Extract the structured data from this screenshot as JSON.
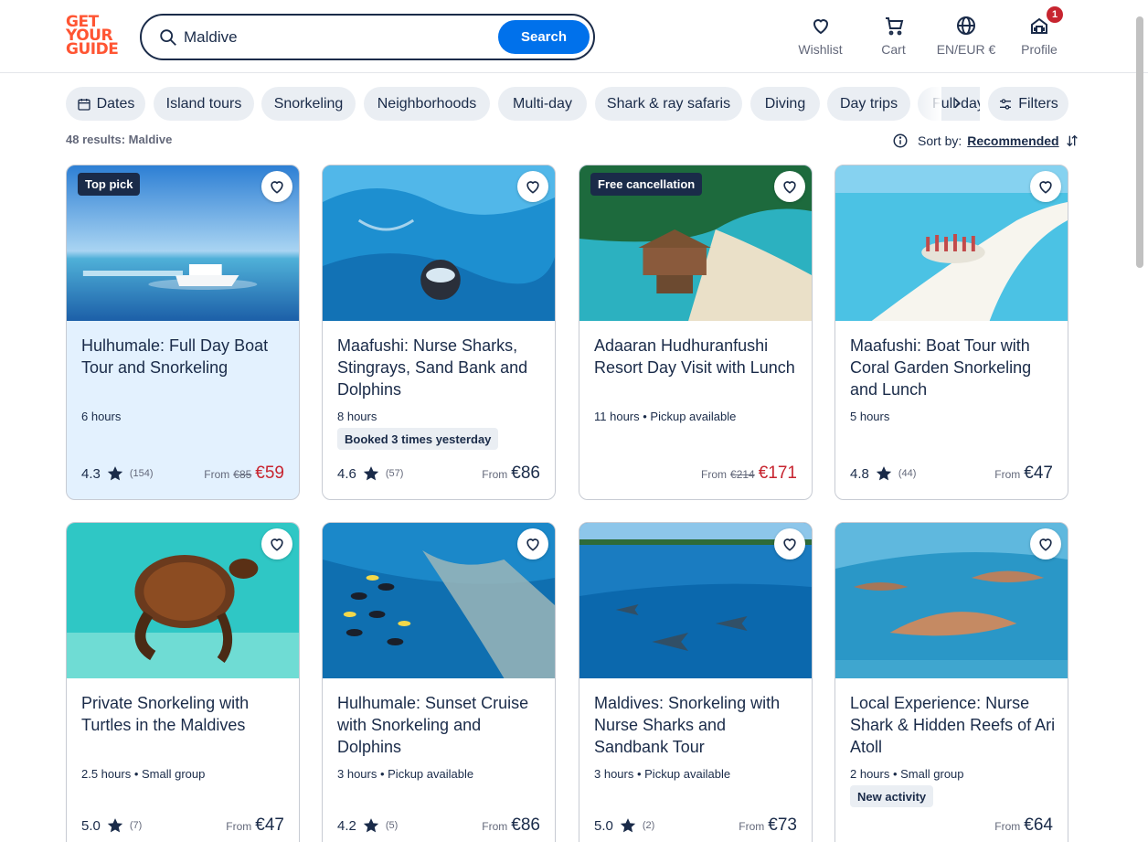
{
  "header": {
    "logo": [
      "GET",
      "YOUR",
      "GUIDE"
    ],
    "search": {
      "value": "Maldive",
      "button": "Search"
    },
    "nav": {
      "wishlist": "Wishlist",
      "cart": "Cart",
      "language": "EN/EUR €",
      "profile": "Profile",
      "profile_badge": "1"
    }
  },
  "chips": [
    "Dates",
    "Island tours",
    "Snorkeling",
    "Neighborhoods",
    "Multi-day",
    "Shark & ray safaris",
    "Diving",
    "Day trips",
    "Full-day"
  ],
  "filters_label": "Filters",
  "results": {
    "count": "48 results: Maldive",
    "sort_label": "Sort by:",
    "sort_value": "Recommended"
  },
  "cards": [
    {
      "badge": "Top pick",
      "title": "Hulhumale: Full Day Boat Tour and Snorkeling",
      "meta": "6 hours",
      "tag": "",
      "rating": "4.3",
      "reviews": "(154)",
      "from": "From",
      "old_price": "€85",
      "price": "€59",
      "sale": true,
      "highlight": true,
      "img": "boat"
    },
    {
      "badge": "",
      "title": "Maafushi: Nurse Sharks, Stingrays, Sand Bank and Dolphins",
      "meta": "8 hours",
      "tag": "Booked 3 times yesterday",
      "rating": "4.6",
      "reviews": "(57)",
      "from": "From",
      "old_price": "",
      "price": "€86",
      "sale": false,
      "highlight": false,
      "img": "snorkel"
    },
    {
      "badge": "Free cancellation",
      "title": "Adaaran Hudhuranfushi Resort Day Visit with Lunch",
      "meta": "11 hours • Pickup available",
      "tag": "",
      "rating": "",
      "reviews": "",
      "from": "From",
      "old_price": "€214",
      "price": "€171",
      "sale": true,
      "highlight": false,
      "img": "resort"
    },
    {
      "badge": "",
      "title": "Maafushi: Boat Tour with Coral Garden Snorkeling and Lunch",
      "meta": "5 hours",
      "tag": "",
      "rating": "4.8",
      "reviews": "(44)",
      "from": "From",
      "old_price": "",
      "price": "€47",
      "sale": false,
      "highlight": false,
      "img": "sandbank"
    },
    {
      "badge": "",
      "title": "Private Snorkeling with Turtles in the Maldives",
      "meta": "2.5 hours • Small group",
      "tag": "",
      "rating": "5.0",
      "reviews": "(7)",
      "from": "From",
      "old_price": "",
      "price": "€47",
      "sale": false,
      "highlight": false,
      "img": "turtle"
    },
    {
      "badge": "",
      "title": "Hulhumale: Sunset Cruise with Snorkeling and Dolphins",
      "meta": "3 hours • Pickup available",
      "tag": "",
      "rating": "4.2",
      "reviews": "(5)",
      "from": "From",
      "old_price": "",
      "price": "€86",
      "sale": false,
      "highlight": false,
      "img": "fish"
    },
    {
      "badge": "",
      "title": "Maldives: Snorkeling with Nurse Sharks and Sandbank Tour",
      "meta": "3 hours • Pickup available",
      "tag": "",
      "rating": "5.0",
      "reviews": "(2)",
      "from": "From",
      "old_price": "",
      "price": "€73",
      "sale": false,
      "highlight": false,
      "img": "sharks"
    },
    {
      "badge": "",
      "title": "Local Experience: Nurse Shark & Hidden Reefs of Ari Atoll",
      "meta": "2 hours • Small group",
      "tag": "New activity",
      "rating": "",
      "reviews": "",
      "from": "From",
      "old_price": "",
      "price": "€64",
      "sale": false,
      "highlight": false,
      "img": "shark2"
    }
  ]
}
